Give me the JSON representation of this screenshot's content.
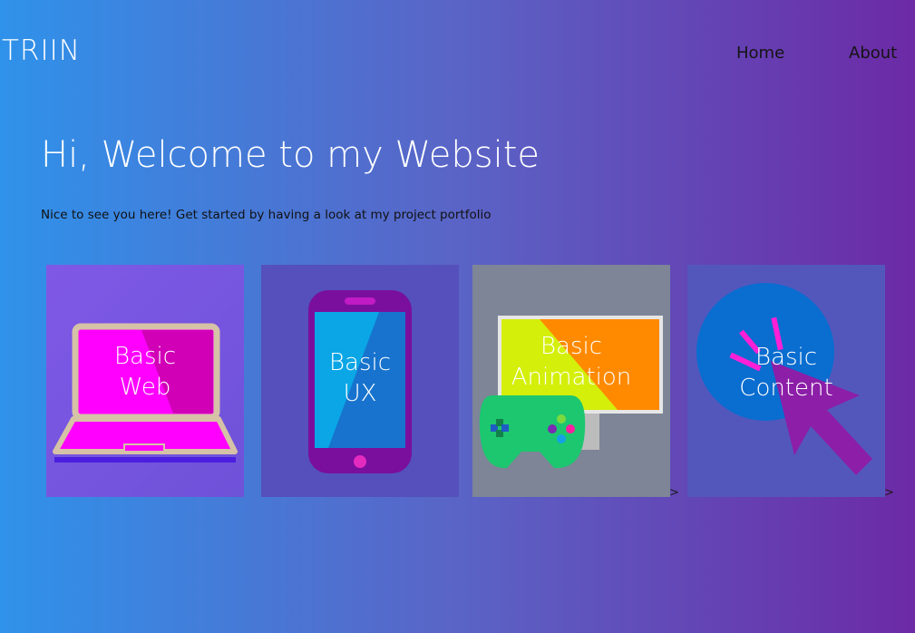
{
  "header": {
    "logo": "TRIIN",
    "nav": {
      "home": "Home",
      "about": "About"
    }
  },
  "hero": {
    "title": "Hi, Welcome to my Website",
    "subtitle": "Nice to see you here! Get started by having a look at my project portfolio"
  },
  "cards": [
    {
      "label": "Basic\nWeb",
      "icon": "laptop-icon"
    },
    {
      "label": "Basic\nUX",
      "icon": "smartphone-icon"
    },
    {
      "label": "Basic\nAnimation",
      "icon": "gamepad-monitor-icon"
    },
    {
      "label": "Basic\nContent",
      "icon": "cursor-click-icon"
    }
  ],
  "arrows": [
    ">",
    ">"
  ],
  "colors": {
    "gradient_start": "#2f92ea",
    "gradient_end": "#6c2aa6",
    "magenta": "#ff00ff",
    "game_green": "#1dc76f",
    "monitor_orange": "#ff8a00"
  }
}
